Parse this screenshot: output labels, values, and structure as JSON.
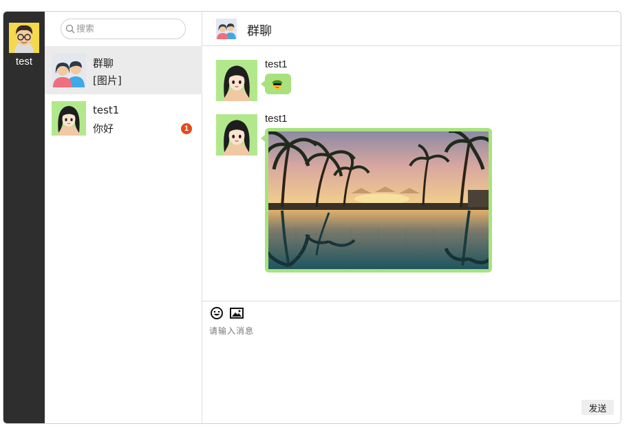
{
  "current_user": {
    "name": "test"
  },
  "search": {
    "placeholder": "搜索"
  },
  "sessions": [
    {
      "name": "群聊",
      "preview": "[图片]",
      "active": true
    },
    {
      "name": "test1",
      "preview": "你好",
      "unread": "1"
    }
  ],
  "chat": {
    "title": "群聊",
    "messages": [
      {
        "sender": "test1",
        "type": "emoji",
        "emoji": "sunglasses-emoji"
      },
      {
        "sender": "test1",
        "type": "image",
        "image": "tropical-resort-pool-sunset"
      }
    ]
  },
  "composer": {
    "placeholder": "请输入消息",
    "send_label": "发送",
    "tools": [
      "emoji-icon",
      "image-icon"
    ]
  },
  "colors": {
    "rail": "#2e2e2e",
    "bubble": "#a8e27e",
    "active_session": "#ebebeb",
    "unread_badge": "#e64a19"
  }
}
